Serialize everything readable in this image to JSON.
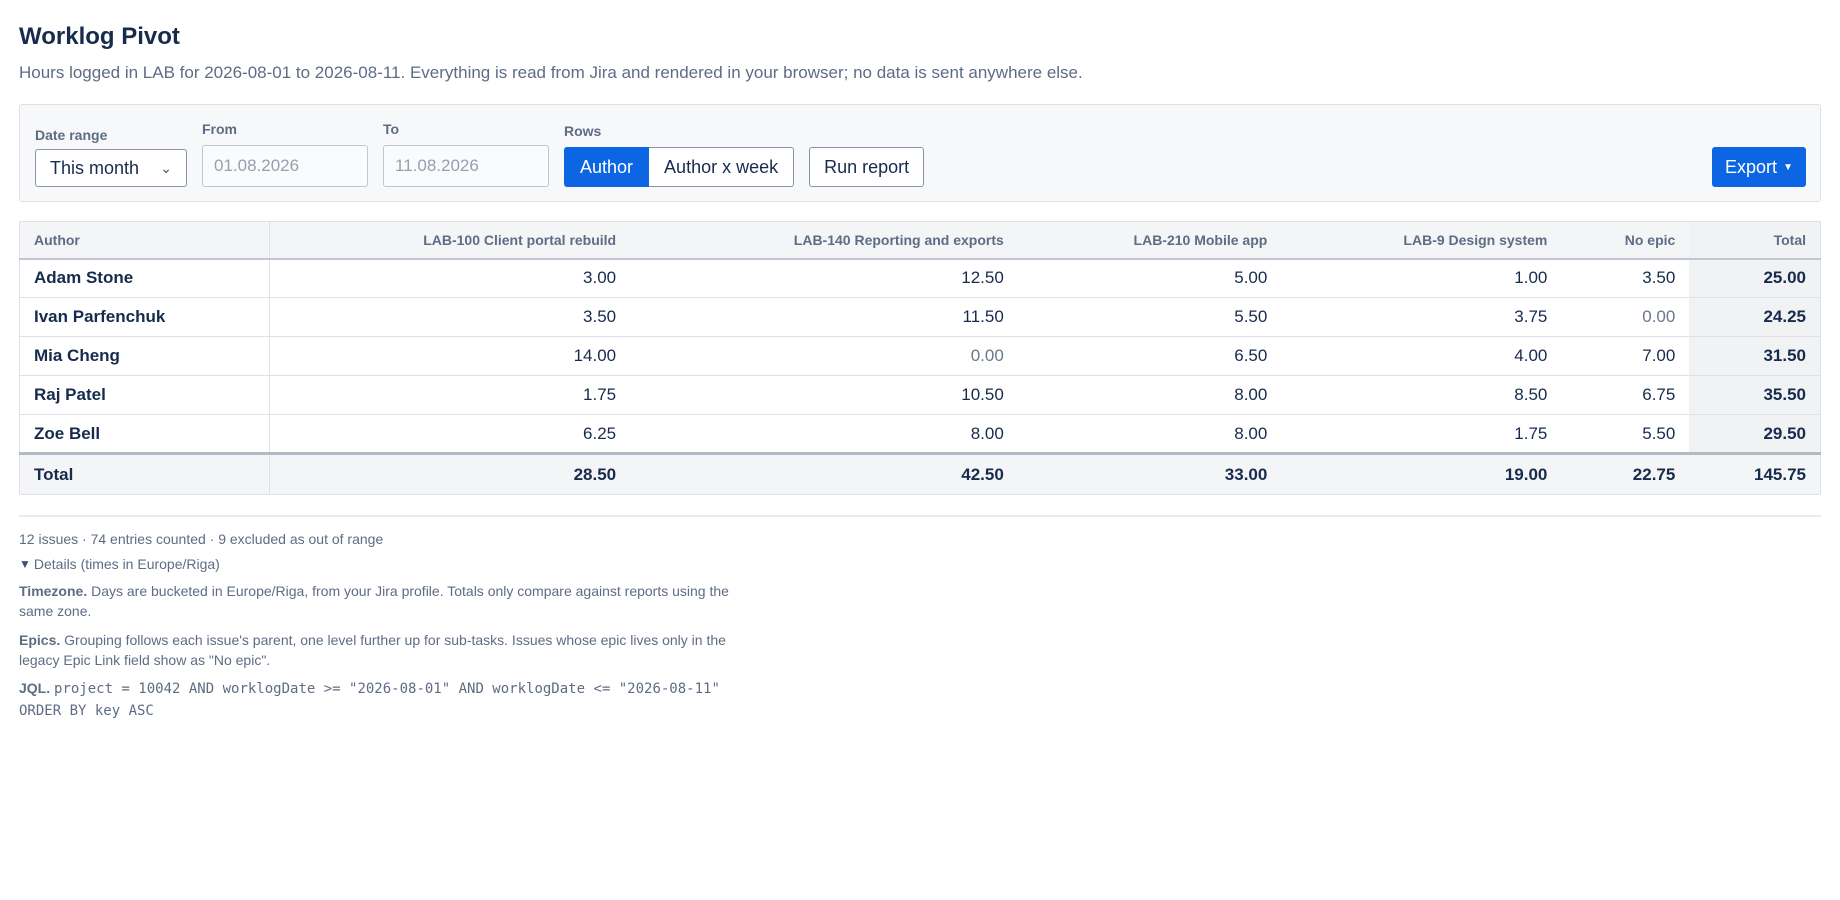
{
  "header": {
    "title": "Worklog Pivot",
    "subtitle": "Hours logged in LAB for 2026-08-01 to 2026-08-11. Everything is read from Jira and rendered in your browser; no data is sent anywhere else."
  },
  "toolbar": {
    "date_range_label": "Date range",
    "date_range_value": "This month",
    "from_label": "From",
    "from_placeholder": "01.08.2026",
    "to_label": "To",
    "to_placeholder": "11.08.2026",
    "rows_label": "Rows",
    "rows_options": [
      "Author",
      "Author x week"
    ],
    "rows_selected": "Author",
    "run_label": "Run report",
    "export_label": "Export"
  },
  "table": {
    "columns": [
      "Author",
      "LAB-100 Client portal rebuild",
      "LAB-140 Reporting and exports",
      "LAB-210 Mobile app",
      "LAB-9 Design system",
      "No epic",
      "Total"
    ],
    "rows": [
      {
        "author": "Adam Stone",
        "cells": [
          "3.00",
          "12.50",
          "5.00",
          "1.00",
          "3.50"
        ],
        "total": "25.00"
      },
      {
        "author": "Ivan Parfenchuk",
        "cells": [
          "3.50",
          "11.50",
          "5.50",
          "3.75",
          "0.00"
        ],
        "total": "24.25"
      },
      {
        "author": "Mia Cheng",
        "cells": [
          "14.00",
          "0.00",
          "6.50",
          "4.00",
          "7.00"
        ],
        "total": "31.50"
      },
      {
        "author": "Raj Patel",
        "cells": [
          "1.75",
          "10.50",
          "8.00",
          "8.50",
          "6.75"
        ],
        "total": "35.50"
      },
      {
        "author": "Zoe Bell",
        "cells": [
          "6.25",
          "8.00",
          "8.00",
          "1.75",
          "5.50"
        ],
        "total": "29.50"
      }
    ],
    "totals": {
      "label": "Total",
      "cells": [
        "28.50",
        "42.50",
        "33.00",
        "19.00",
        "22.75"
      ],
      "total": "145.75"
    }
  },
  "footer": {
    "stats": "12 issues · 74 entries counted · 9 excluded as out of range",
    "details_label": "Details (times in Europe/Riga)",
    "timezone_title": "Timezone.",
    "timezone_text": "Days are bucketed in Europe/Riga, from your Jira profile. Totals only compare against reports using the same zone.",
    "epics_title": "Epics.",
    "epics_text": "Grouping follows each issue's parent, one level further up for sub-tasks. Issues whose epic lives only in the legacy Epic Link field show as \"No epic\".",
    "jql_title": "JQL.",
    "jql_text": "project = 10042 AND worklogDate >= \"2026-08-01\" AND worklogDate <= \"2026-08-11\" ORDER BY key ASC"
  },
  "icons": {
    "select_chevron": "chevron-down-icon",
    "export_caret": "caret-down-icon",
    "details_triangle": "triangle-down-icon"
  },
  "colors": {
    "primary": "#0c66e4",
    "text": "#172b4d",
    "muted": "#5e6c84"
  }
}
